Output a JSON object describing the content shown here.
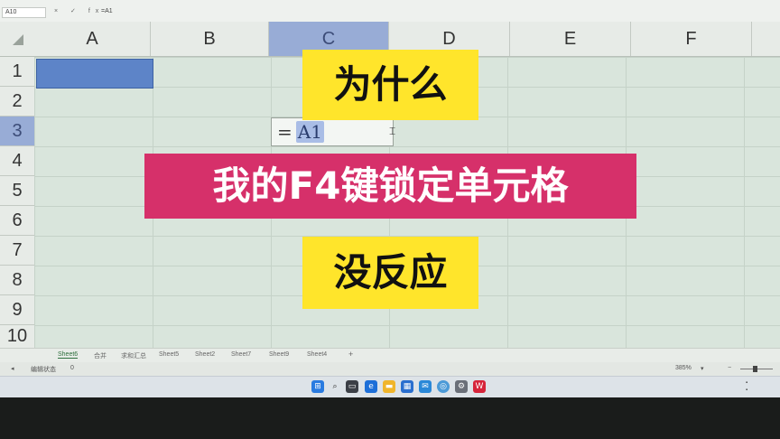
{
  "formula_bar": {
    "name_box": "A10",
    "icons": "× ✓ fx",
    "content": "=A1"
  },
  "columns": [
    "A",
    "B",
    "C",
    "D",
    "E",
    "F"
  ],
  "rows": [
    "1",
    "2",
    "3",
    "4",
    "5",
    "6",
    "7",
    "8",
    "9",
    "10"
  ],
  "editing_cell": {
    "eq": "=",
    "ref": "A1"
  },
  "captions": {
    "line1": "为什么",
    "line2": "我的F4键锁定单元格",
    "line3": "没反应"
  },
  "sheet_tabs": [
    "Sheet6",
    "合并",
    "求和汇总",
    "Sheet5",
    "Sheet2",
    "Sheet7",
    "Sheet9",
    "Sheet4"
  ],
  "status": {
    "mode": "编辑状态",
    "value": "0",
    "zoom": "385%"
  },
  "colors": {
    "selected_header": "#98acd6",
    "selected_cell": "#5d84c8",
    "caption_yellow": "#ffe52b",
    "caption_pink": "#d6306a",
    "grid": "#d9e5dc"
  },
  "taskbar": {
    "icons": [
      "windows-start-icon",
      "search-icon",
      "task-view-icon",
      "edge-icon",
      "file-explorer-icon",
      "store-icon",
      "mail-icon",
      "chrome-icon",
      "settings-icon",
      "wps-icon"
    ]
  }
}
